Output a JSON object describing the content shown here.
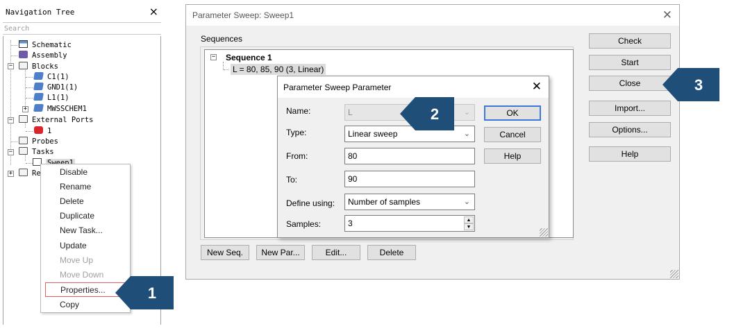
{
  "nav_tree": {
    "title": "Navigation Tree",
    "search_placeholder": "Search",
    "items": {
      "schematic": "Schematic",
      "assembly": "Assembly",
      "blocks": "Blocks",
      "c1": "C1(1)",
      "gnd1": "GND1(1)",
      "l1": "L1(1)",
      "mwsschem1": "MWSSCHEM1",
      "external_ports": "External Ports",
      "port1": "1",
      "probes": "Probes",
      "tasks": "Tasks",
      "sweep1": "Sweep1",
      "results_truncated": "Re"
    }
  },
  "context_menu": {
    "items": [
      {
        "label": "Disable",
        "disabled": false
      },
      {
        "label": "Rename",
        "disabled": false
      },
      {
        "label": "Delete",
        "disabled": false
      },
      {
        "label": "Duplicate",
        "disabled": false
      },
      {
        "label": "New Task...",
        "disabled": false
      },
      {
        "label": "Update",
        "disabled": false
      },
      {
        "label": "Move Up",
        "disabled": true
      },
      {
        "label": "Move Down",
        "disabled": true
      },
      {
        "label": "Properties...",
        "disabled": false,
        "highlighted": true
      },
      {
        "label": "Copy",
        "disabled": false
      }
    ]
  },
  "callouts": {
    "one": "1",
    "two": "2",
    "three": "3",
    "color": "#1f4e79"
  },
  "sweep_dialog": {
    "title": "Parameter Sweep: Sweep1",
    "sequences_label": "Sequences",
    "sequence_name": "Sequence 1",
    "sequence_param": "L = 80, 85, 90 (3, Linear)",
    "buttons": {
      "check": "Check",
      "start": "Start",
      "close": "Close",
      "import": "Import...",
      "options": "Options...",
      "help": "Help",
      "new_seq": "New Seq.",
      "new_par": "New Par...",
      "edit": "Edit...",
      "delete": "Delete"
    }
  },
  "param_dialog": {
    "title": "Parameter Sweep Parameter",
    "name_label": "Name:",
    "name_value": "L",
    "type_label": "Type:",
    "type_value": "Linear sweep",
    "from_label": "From:",
    "from_value": "80",
    "to_label": "To:",
    "to_value": "90",
    "define_label": "Define using:",
    "define_value": "Number of samples",
    "samples_label": "Samples:",
    "samples_value": "3",
    "ok": "OK",
    "cancel": "Cancel",
    "help": "Help"
  }
}
